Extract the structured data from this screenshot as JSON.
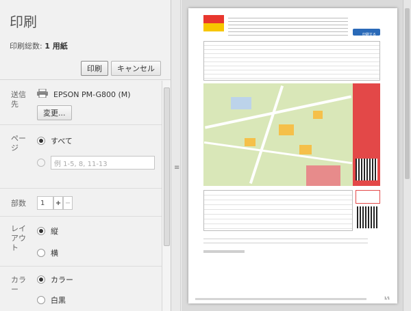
{
  "header": {
    "title": "印刷",
    "total_label": "印刷総数:",
    "total_value": "1 用紙",
    "print_button": "印刷",
    "cancel_button": "キャンセル"
  },
  "destination": {
    "label": "送信先",
    "printer_name": "EPSON PM-G800 (M)",
    "change_button": "変更..."
  },
  "pages": {
    "label": "ページ",
    "all_label": "すべて",
    "range_placeholder": "例 1-5, 8, 11-13"
  },
  "copies": {
    "label": "部数",
    "value": "1",
    "plus": "+",
    "minus": "−"
  },
  "layout": {
    "label": "レイアウト",
    "portrait": "縦",
    "landscape": "横"
  },
  "color": {
    "label": "カラー",
    "color_option": "カラー",
    "bw_option": "白黒"
  },
  "preview": {
    "page_number": "1/1",
    "print_link": "印刷する"
  }
}
